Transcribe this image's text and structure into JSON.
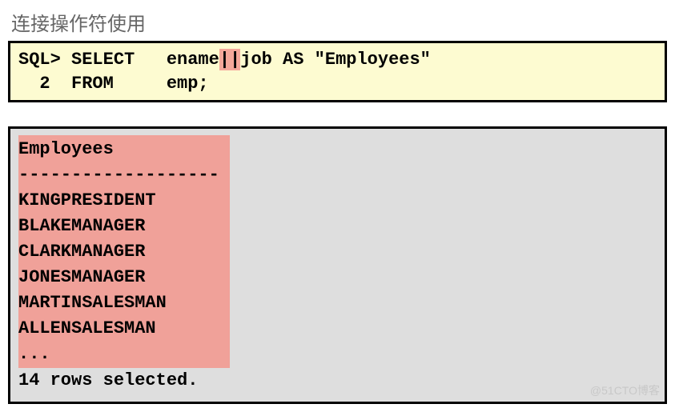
{
  "title": "连接操作符使用",
  "sql": {
    "line1_a": "SQL> SELECT   ename",
    "op": "||",
    "line1_b": "job AS \"Employees\"",
    "line2": "  2  FROM     emp;"
  },
  "result": {
    "header": "Employees",
    "divider": "-------------------",
    "rows": [
      "KINGPRESIDENT",
      "BLAKEMANAGER",
      "CLARKMANAGER",
      "JONESMANAGER",
      "MARTINSALESMAN",
      "ALLENSALESMAN",
      "..."
    ],
    "footer": "14 rows selected."
  },
  "watermark": "@51CTO博客"
}
